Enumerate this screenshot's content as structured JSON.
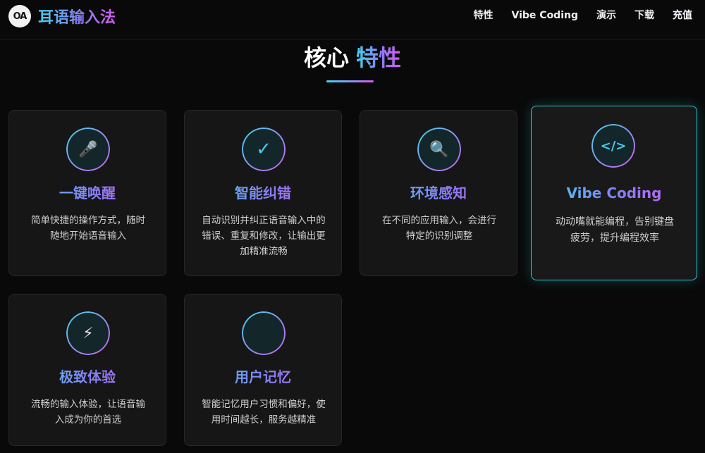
{
  "header": {
    "logo_mark": "OA",
    "app_name": "耳语输入法",
    "nav": [
      "特性",
      "Vibe Coding",
      "演示",
      "下载",
      "充值"
    ]
  },
  "section": {
    "title_plain": "核心",
    "title_accent": "特性"
  },
  "features": [
    {
      "icon": "microphone-icon",
      "glyph": "🎤",
      "title": "一键唤醒",
      "desc": "简单快捷的操作方式，随时随地开始语音输入"
    },
    {
      "icon": "checkmark-icon",
      "glyph": "✓",
      "title": "智能纠错",
      "desc": "自动识别并纠正语音输入中的错误、重复和修改，让输出更加精准流畅"
    },
    {
      "icon": "magnifier-icon",
      "glyph": "🔍",
      "title": "环境感知",
      "desc": "在不同的应用输入，会进行特定的识别调整"
    },
    {
      "icon": "code-icon",
      "glyph": "</>",
      "title": "Vibe Coding",
      "desc": "动动嘴就能编程，告别键盘疲劳，提升编程效率"
    },
    {
      "icon": "lightning-icon",
      "glyph": "⚡",
      "title": "极致体验",
      "desc": "流畅的输入体验，让语音输入成为你的首选"
    },
    {
      "icon": "memory-icon",
      "glyph": "",
      "title": "用户记忆",
      "desc": "智能记忆用户习惯和偏好，使用时间越长，服务越精准"
    }
  ],
  "colors": {
    "accent_cyan": "#3fd5f0",
    "accent_purple": "#d65af0",
    "card_bg": "#161616",
    "active_border": "#2fc7d6"
  }
}
